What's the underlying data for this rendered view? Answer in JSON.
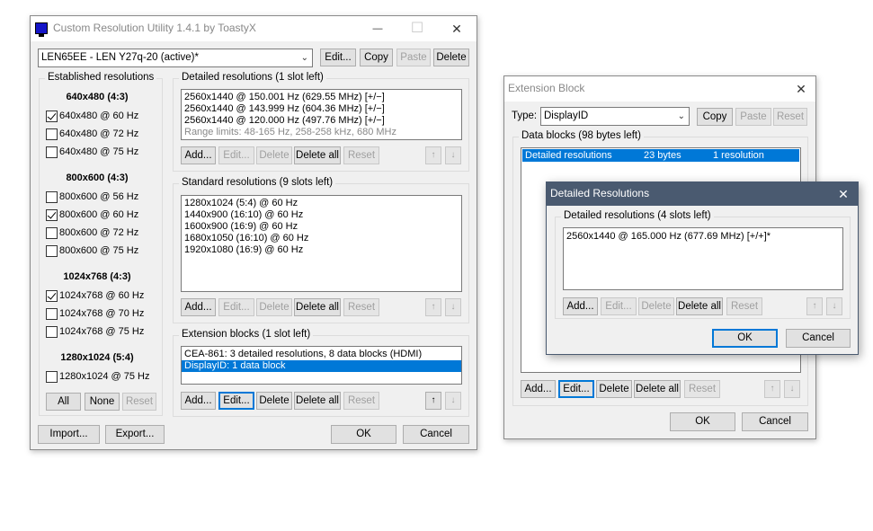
{
  "main": {
    "title": "Custom Resolution Utility 1.4.1 by ToastyX",
    "monitor": "LEN65EE - LEN Y27q-20 (active)*",
    "top_buttons": [
      "Edit...",
      "Copy",
      "Paste",
      "Delete"
    ],
    "established": {
      "label": "Established resolutions",
      "groups": [
        {
          "heading": "640x480 (4:3)",
          "items": [
            {
              "label": "640x480 @ 60 Hz",
              "checked": true
            },
            {
              "label": "640x480 @ 72 Hz",
              "checked": false
            },
            {
              "label": "640x480 @ 75 Hz",
              "checked": false
            }
          ]
        },
        {
          "heading": "800x600 (4:3)",
          "items": [
            {
              "label": "800x600 @ 56 Hz",
              "checked": false
            },
            {
              "label": "800x600 @ 60 Hz",
              "checked": true
            },
            {
              "label": "800x600 @ 72 Hz",
              "checked": false
            },
            {
              "label": "800x600 @ 75 Hz",
              "checked": false
            }
          ]
        },
        {
          "heading": "1024x768 (4:3)",
          "items": [
            {
              "label": "1024x768 @ 60 Hz",
              "checked": true
            },
            {
              "label": "1024x768 @ 70 Hz",
              "checked": false
            },
            {
              "label": "1024x768 @ 75 Hz",
              "checked": false
            }
          ]
        },
        {
          "heading": "1280x1024 (5:4)",
          "items": [
            {
              "label": "1280x1024 @ 75 Hz",
              "checked": false
            }
          ]
        }
      ],
      "buttons": [
        "All",
        "None",
        "Reset"
      ]
    },
    "detailed": {
      "label": "Detailed resolutions (1 slot left)",
      "items": [
        "2560x1440 @ 150.001 Hz (629.55 MHz) [+/−]",
        "2560x1440 @ 143.999 Hz (604.36 MHz) [+/−]",
        "2560x1440 @ 120.000 Hz (497.76 MHz) [+/−]"
      ],
      "range": "Range limits: 48-165 Hz, 258-258 kHz, 680 MHz"
    },
    "standard": {
      "label": "Standard resolutions (9 slots left)",
      "items": [
        "1280x1024 (5:4) @ 60 Hz",
        "1440x900 (16:10) @ 60 Hz",
        "1600x900 (16:9) @ 60 Hz",
        "1680x1050 (16:10) @ 60 Hz",
        "1920x1080 (16:9) @ 60 Hz"
      ]
    },
    "extension": {
      "label": "Extension blocks (1 slot left)",
      "items": [
        "CEA-861: 3 detailed resolutions, 8 data blocks (HDMI)",
        "DisplayID: 1 data block"
      ]
    },
    "list_buttons": [
      "Add...",
      "Edit...",
      "Delete",
      "Delete all",
      "Reset"
    ],
    "arrows": {
      "up": "↑",
      "down": "↓"
    },
    "bottom_buttons": {
      "import": "Import...",
      "export": "Export...",
      "ok": "OK",
      "cancel": "Cancel"
    }
  },
  "ext_block": {
    "title": "Extension Block",
    "type_label": "Type:",
    "type_value": "DisplayID",
    "buttons": [
      "Copy",
      "Paste",
      "Reset"
    ],
    "data_blocks_label": "Data blocks (98 bytes left)",
    "row": {
      "name": "Detailed resolutions",
      "size": "23 bytes",
      "info": "1 resolution"
    },
    "list_buttons": [
      "Add...",
      "Edit...",
      "Delete",
      "Delete all",
      "Reset"
    ],
    "ok": "OK",
    "cancel": "Cancel"
  },
  "detailed_dialog": {
    "title": "Detailed Resolutions",
    "label": "Detailed resolutions (4 slots left)",
    "item": "2560x1440 @ 165.000 Hz (677.69 MHz) [+/+]*",
    "list_buttons": [
      "Add...",
      "Edit...",
      "Delete",
      "Delete all",
      "Reset"
    ],
    "ok": "OK",
    "cancel": "Cancel"
  },
  "icons": {
    "close": "✕",
    "maximize": "☐",
    "minimize": "—",
    "dropdown": "⌵"
  },
  "colors": {
    "selection": "#0078d7",
    "dialog_title_bar": "#4a5a70",
    "app_icon": "#1515c8"
  }
}
